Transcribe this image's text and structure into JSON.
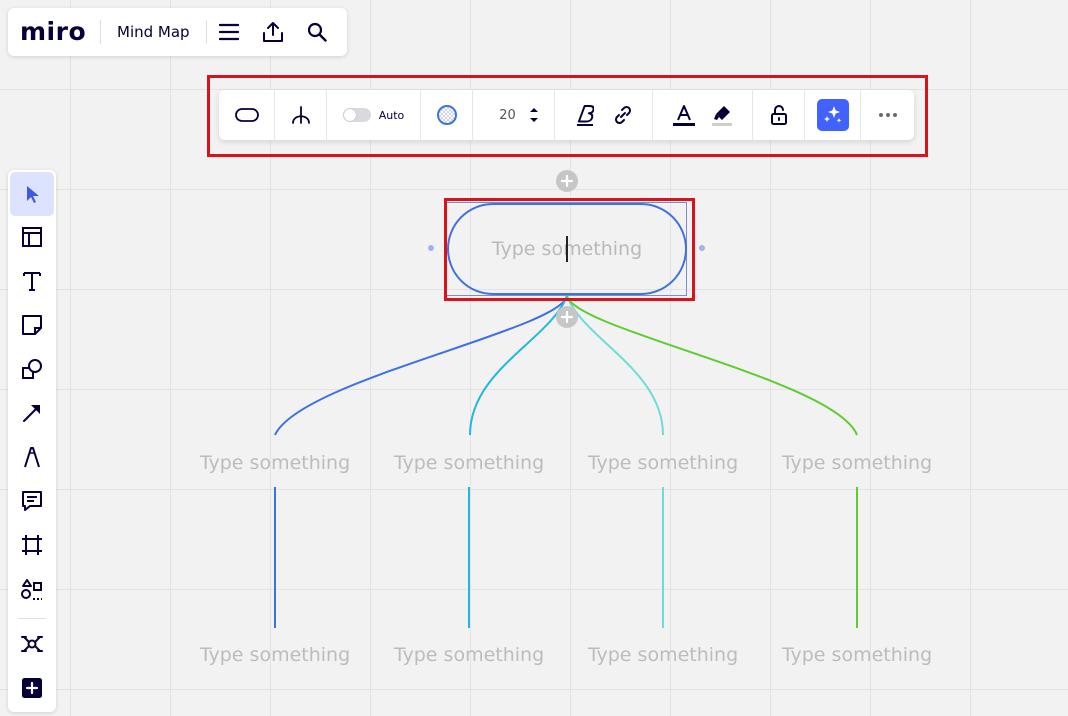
{
  "header": {
    "logo": "miro",
    "board_title": "Mind Map"
  },
  "toolbar": {
    "auto_label": "Auto",
    "font_size": "20"
  },
  "mindmap": {
    "root_text": "Type something",
    "children": [
      {
        "text": "Type something",
        "color": "#3d72e0"
      },
      {
        "text": "Type something",
        "color": "#23b7e0"
      },
      {
        "text": "Type something",
        "color": "#6fdcd9"
      },
      {
        "text": "Type something",
        "color": "#5cce32"
      }
    ],
    "grandchildren": [
      {
        "text": "Type something",
        "color": "#3d72e0"
      },
      {
        "text": "Type something",
        "color": "#23b7e0"
      },
      {
        "text": "Type something",
        "color": "#6fdcd9"
      },
      {
        "text": "Type something",
        "color": "#5cce32"
      }
    ]
  },
  "colors": {
    "accent": "#4262ff",
    "highlight": "#d9131c",
    "text_dark": "#050038"
  },
  "icons": {
    "sidebar": [
      "cursor-icon",
      "templates-icon",
      "text-icon",
      "sticky-note-icon",
      "shapes-icon",
      "arrow-icon",
      "pen-icon",
      "comment-icon",
      "frame-icon",
      "more-tools-icon",
      "mindmap-icon",
      "add-icon"
    ],
    "toolbar": [
      "shape-icon",
      "branch-style-icon",
      "auto-layout-toggle",
      "fill-color-icon",
      "font-size-stepper",
      "bold-icon",
      "link-icon",
      "text-color-icon",
      "highlight-icon",
      "lock-icon",
      "ai-assist-icon",
      "more-icon"
    ]
  }
}
